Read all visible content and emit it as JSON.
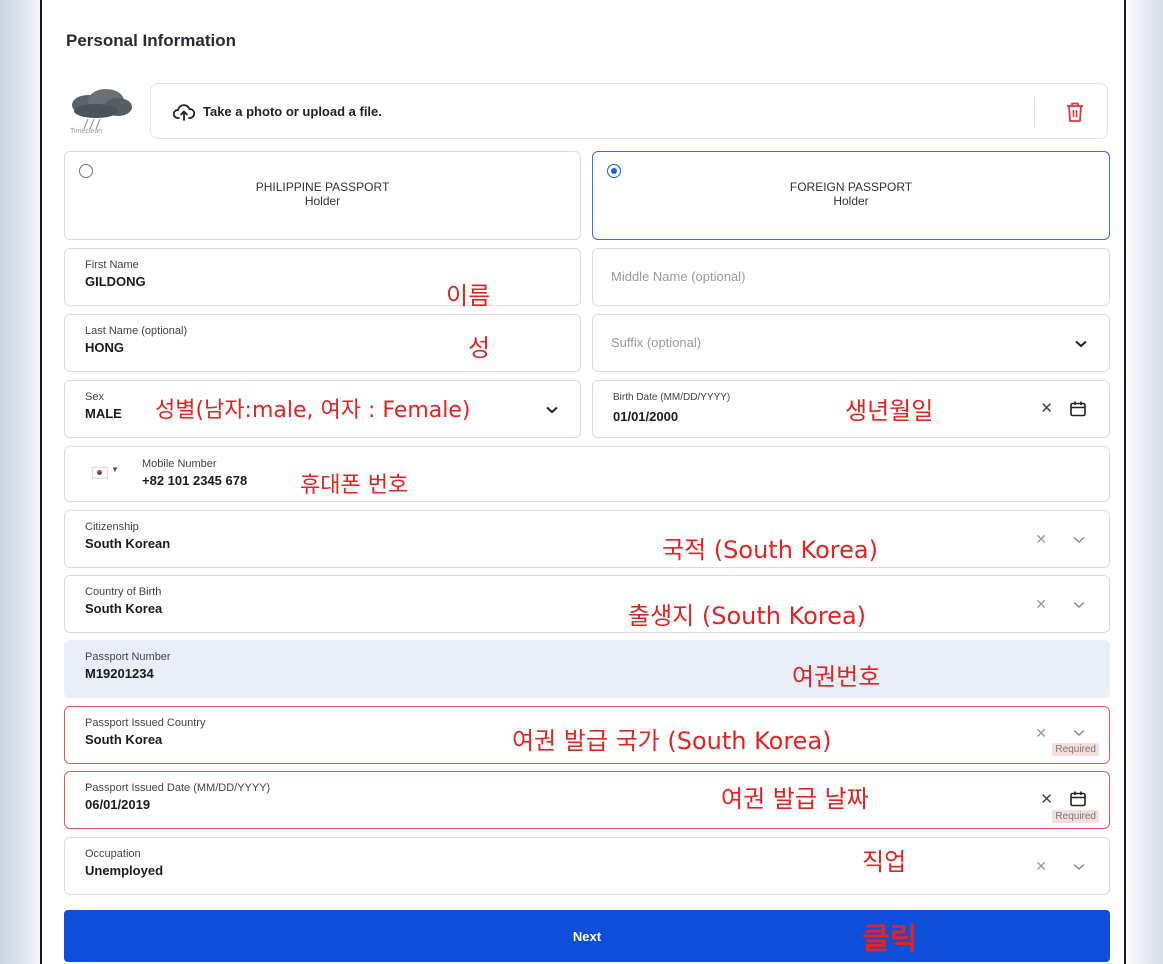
{
  "page": {
    "title": "Personal Information"
  },
  "upload": {
    "logo_caption": "Timeclean",
    "label": "Take a photo or upload a file."
  },
  "passport_type": {
    "options": [
      {
        "title": "PHILIPPINE PASSPORT",
        "subtitle": "Holder",
        "selected": false
      },
      {
        "title": "FOREIGN PASSPORT",
        "subtitle": "Holder",
        "selected": true
      }
    ]
  },
  "fields": {
    "first_name": {
      "label": "First Name",
      "value": "GILDONG"
    },
    "middle_name": {
      "placeholder": "Middle Name (optional)"
    },
    "last_name": {
      "label": "Last Name (optional)",
      "value": "HONG"
    },
    "suffix": {
      "placeholder": "Suffix (optional)"
    },
    "sex": {
      "label": "Sex",
      "value": "MALE"
    },
    "birth_date": {
      "label": "Birth Date (MM/DD/YYYY)",
      "value": "01/01/2000"
    },
    "mobile": {
      "label": "Mobile Number",
      "value": "+82 101 2345 678"
    },
    "citizenship": {
      "label": "Citizenship",
      "value": "South Korean"
    },
    "country_of_birth": {
      "label": "Country of Birth",
      "value": "South Korea"
    },
    "passport_number": {
      "label": "Passport Number",
      "value": "M19201234"
    },
    "passport_country": {
      "label": "Passport Issued Country",
      "value": "South Korea",
      "error": "Required"
    },
    "passport_date": {
      "label": "Passport Issued Date (MM/DD/YYYY)",
      "value": "06/01/2019",
      "error": "Required"
    },
    "occupation": {
      "label": "Occupation",
      "value": "Unemployed"
    }
  },
  "annotations": {
    "first_name": "이름",
    "last_name": "성",
    "sex": "성별(남자:male, 여자 : Female)",
    "birth_date": "생년월일",
    "mobile": "휴대폰 번호",
    "citizenship": "국적 (South Korea)",
    "country_of_birth": "출생지 (South Korea)",
    "passport_number": "여권번호",
    "passport_country": "여권 발급 국가 (South Korea)",
    "passport_date": "여권 발급 날짜",
    "occupation": "직업",
    "next": "클릭"
  },
  "actions": {
    "next_label": "Next"
  },
  "icons": {
    "upload": "cloud-upload-icon",
    "delete": "trash-icon",
    "clear": "close-icon",
    "dropdown": "chevron-down-icon",
    "calendar": "calendar-icon"
  },
  "colors": {
    "primary": "#0d4fd8",
    "selected_border": "#3a6de0",
    "error": "#e05a5a",
    "annotation": "#e52222",
    "delete_icon": "#d83a3a",
    "filled_field": "#e9eef8"
  }
}
